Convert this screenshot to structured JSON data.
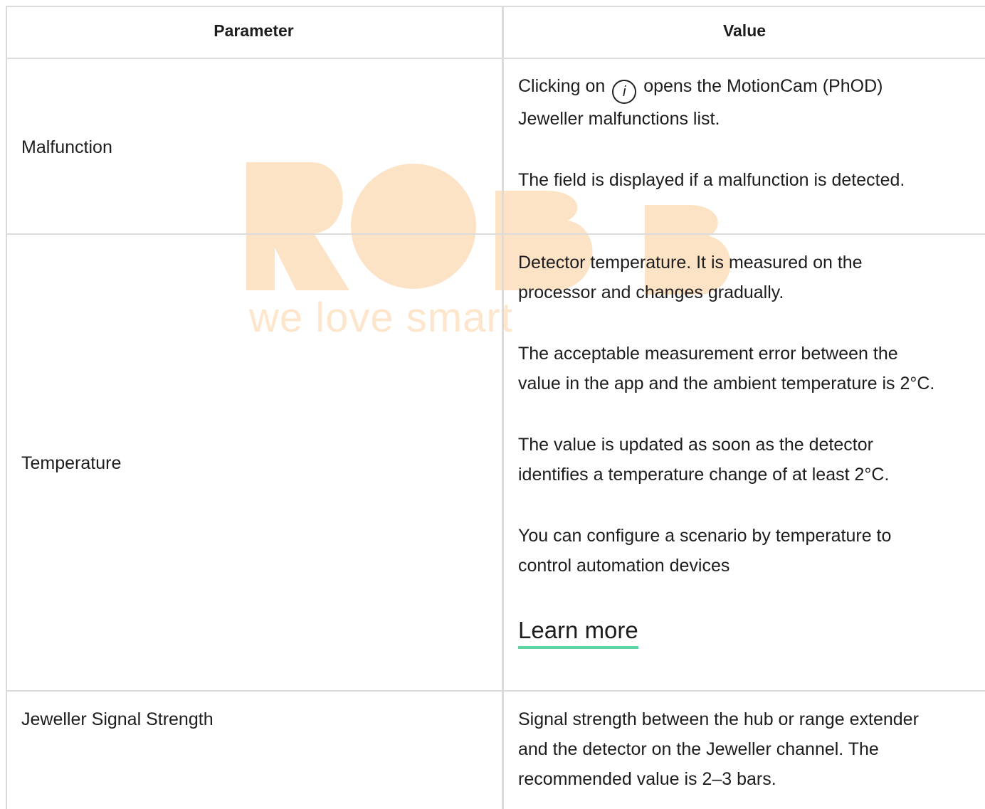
{
  "table": {
    "headers": {
      "parameter": "Parameter",
      "value": "Value"
    },
    "rows": [
      {
        "parameter": "Malfunction",
        "value_line1_before_icon": "Clicking on",
        "value_icon": "i",
        "value_line1_after_icon": "opens the MotionCam (PhOD)",
        "value_line2": "Jeweller malfunctions list.",
        "value_para2": "The field is displayed if a malfunction is detected."
      },
      {
        "parameter": "Temperature",
        "paragraphs": [
          [
            "Detector temperature. It is measured on the",
            "processor and changes gradually."
          ],
          [
            "The acceptable measurement error between the",
            "value in the app and the ambient temperature is 2°C."
          ],
          [
            "The value is updated as soon as the detector",
            "identifies a temperature change of at least 2°C."
          ],
          [
            "You can configure a scenario by temperature to",
            "control automation devices"
          ]
        ],
        "link": "Learn more"
      },
      {
        "parameter": "Jeweller Signal Strength",
        "lines": [
          "Signal strength between the hub or range extender",
          "and the detector on the Jeweller channel. The",
          "recommended value is 2–3 bars."
        ]
      }
    ]
  },
  "watermark": {
    "tagline": "we love smart",
    "color": "#fdd9b0"
  },
  "colors": {
    "link_underline": "#5fd3a4",
    "border": "#dcdcdc"
  }
}
